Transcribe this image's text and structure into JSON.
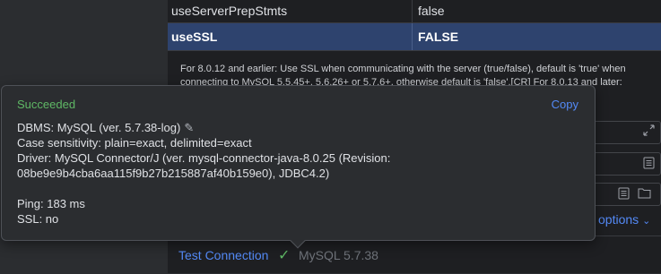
{
  "properties": {
    "rows": [
      {
        "name": "useServerPrepStmts",
        "value": "false"
      },
      {
        "name": "useSSL",
        "value": "FALSE"
      }
    ],
    "description_line1": "For 8.0.12 and earlier: Use SSL when communicating with the server (true/false), default is 'true' when",
    "description_line2": "connecting to MySQL 5.5.45+, 5.6.26+ or 5.7.6+, otherwise default is 'false'.[CR] For 8.0.13 and later:"
  },
  "advanced": {
    "label": "options"
  },
  "bottom": {
    "test_connection_label": "Test Connection",
    "server_version": "MySQL 5.7.38"
  },
  "popup": {
    "status": "Succeeded",
    "copy_label": "Copy",
    "dbms": "DBMS: MySQL (ver. 5.7.38-log)",
    "case_sensitivity": "Case sensitivity: plain=exact, delimited=exact",
    "driver_line1": "Driver: MySQL Connector/J (ver. mysql-connector-java-8.0.25 (Revision:",
    "driver_line2": "08be9e9b4cba6aa115f9b27b215887af40b159e0), JDBC4.2)",
    "ping": "Ping: 183 ms",
    "ssl": "SSL: no"
  },
  "colors": {
    "success": "#5fb865",
    "link": "#548af7",
    "selected_row": "#2e436e"
  },
  "icons": [
    "pencil-icon",
    "expand-icon",
    "text-field-icon",
    "folder-icon",
    "check-icon",
    "chevron-down-icon"
  ]
}
